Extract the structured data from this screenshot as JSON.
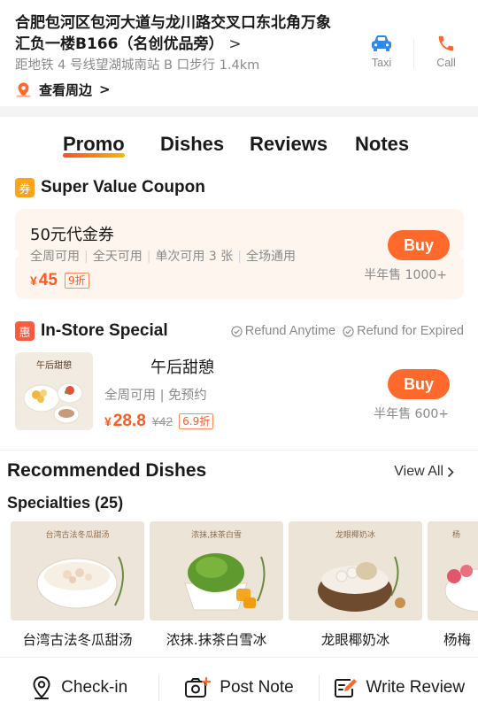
{
  "header": {
    "address": "合肥包河区包河大道与龙川路交叉口东北角万象汇负一楼B166（名创优品旁）",
    "address_chevron": ">",
    "transit": "距地铁 4 号线望湖城南站 B 口步行 1.4km",
    "nearby": "查看周边",
    "nearby_chevron": ">",
    "actions": [
      {
        "label": "Taxi",
        "icon": "taxi-icon",
        "color": "#2f8ae5"
      },
      {
        "label": "Call",
        "icon": "phone-icon",
        "color": "#ff6a2c"
      }
    ]
  },
  "tabs": [
    {
      "label": "Promo",
      "active": true
    },
    {
      "label": "Dishes",
      "active": false
    },
    {
      "label": "Reviews",
      "active": false
    },
    {
      "label": "Notes",
      "active": false
    }
  ],
  "coupon_section": {
    "badge": "券",
    "badge_color": "#ffa31a",
    "title": "Super Value Coupon",
    "coupon": {
      "title": "50元代金券",
      "tags": [
        "全周可用",
        "全天可用",
        "单次可用 3 张",
        "全场通用"
      ],
      "currency": "¥",
      "price": "45",
      "discount": "9折",
      "buy_label": "Buy",
      "sold": "半年售 1000+"
    }
  },
  "special_section": {
    "badge": "惠",
    "badge_color": "#ff5a3c",
    "title": "In-Store Special",
    "guarantees": [
      "Refund Anytime",
      "Refund for Expired"
    ],
    "deal": {
      "image_caption": "午后甜憩",
      "name": "午后甜憩",
      "tags": "全周可用 | 免预约",
      "currency": "¥",
      "price": "28.8",
      "original_price": "¥42",
      "discount": "6.9折",
      "buy_label": "Buy",
      "sold": "半年售 600+"
    }
  },
  "recommended": {
    "title": "Recommended Dishes",
    "view_all": "View All",
    "subtitle": "Specialties (25)",
    "dishes": [
      {
        "name": "台湾古法冬瓜甜汤",
        "caption": "台湾古法冬瓜甜汤"
      },
      {
        "name": "浓抹.抹茶白雪冰",
        "caption": "浓抹,抹茶白雪"
      },
      {
        "name": "龙眼椰奶冰",
        "caption": "龙眼椰奶冰"
      },
      {
        "name": "杨梅",
        "caption": "杨"
      }
    ]
  },
  "bottom_bar": [
    {
      "label": "Check-in",
      "icon": "location-pin-icon"
    },
    {
      "label": "Post Note",
      "icon": "camera-plus-icon"
    },
    {
      "label": "Write Review",
      "icon": "edit-review-icon"
    }
  ],
  "colors": {
    "accent": "#ff6a2c",
    "price": "#ff5a1f",
    "coupon_bg": "#fdf5ee",
    "muted_text": "#8a8a8a"
  }
}
